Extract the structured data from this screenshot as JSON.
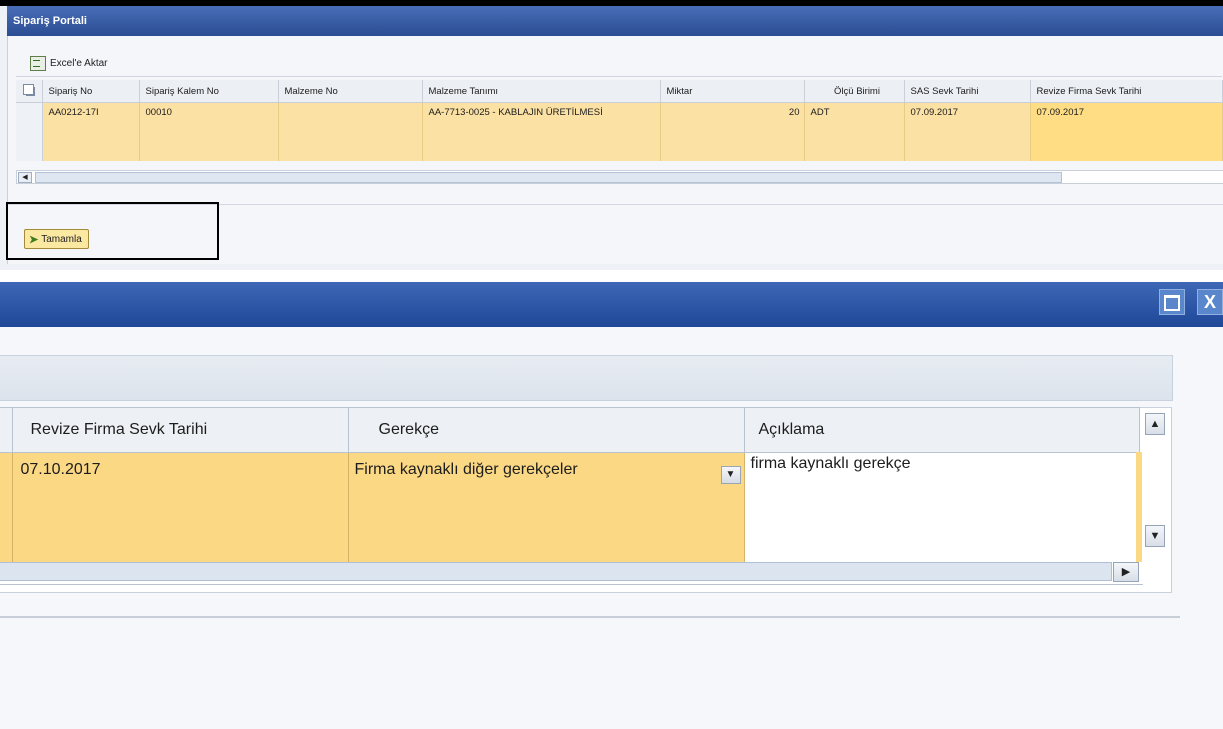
{
  "top_window": {
    "title": "Sipariş Portali",
    "toolbar": {
      "excel_label": "Excel'e Aktar",
      "excel_icon": "excel-icon"
    },
    "columns": [
      "Sipariş No",
      "Sipariş Kalem No",
      "Malzeme No",
      "Malzeme Tanımı",
      "Miktar",
      "Ölçü Birimi",
      "SAS Sevk Tarihi",
      "Revize Firma Sevk Tarihi"
    ],
    "row": {
      "siparis_no": "AA0212-17I",
      "kalem_no": "00010",
      "malzeme_no": "",
      "malzeme_tanimi": "AA-7713-0025 - KABLAJIN ÜRETİLMESİ",
      "miktar": "20",
      "olcu_birimi": "ADT",
      "sas_sevk_tarihi": "07.09.2017",
      "revize_firma_sevk_tarihi": "07.09.2017"
    },
    "tamamla_label": "Tamamla",
    "tamamla_icon": "confirm-arrow-icon"
  },
  "bottom_window": {
    "window_buttons": {
      "maximize_icon": "maximize-icon",
      "close_icon": "close-icon",
      "close_glyph": "X"
    },
    "columns": [
      "Revize Firma Sevk Tarihi",
      "Gerekçe",
      "Açıklama"
    ],
    "row": {
      "revize_firma_sevk_tarihi": "07.10.2017",
      "gerekce": "Firma kaynaklı diğer gerekçeler",
      "aciklama": "firma kaynaklı gerekçe"
    }
  },
  "colors": {
    "titlebar": "#2a4c93",
    "selected_row": "#fbd884",
    "highlight_cell": "#fedd85",
    "grid_header": "#edf0f4"
  }
}
